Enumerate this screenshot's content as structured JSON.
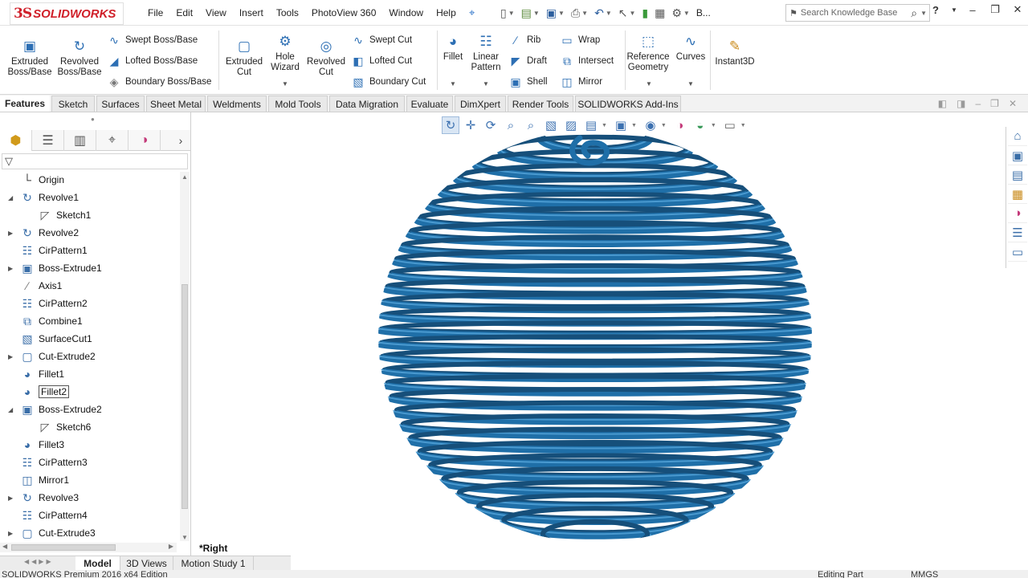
{
  "app": {
    "logo_ds": "3S",
    "logo_name": "SOLIDWORKS"
  },
  "menu": [
    "File",
    "Edit",
    "View",
    "Insert",
    "Tools",
    "PhotoView 360",
    "Window",
    "Help"
  ],
  "quick_access": {
    "extra_label": "B...",
    "search_placeholder": "Search Knowledge Base",
    "help": "?"
  },
  "ribbon": {
    "extruded_boss": [
      "Extruded",
      "Boss/Base"
    ],
    "revolved_boss": [
      "Revolved",
      "Boss/Base"
    ],
    "swept_boss": "Swept Boss/Base",
    "lofted_boss": "Lofted Boss/Base",
    "boundary_boss": "Boundary Boss/Base",
    "extruded_cut": [
      "Extruded",
      "Cut"
    ],
    "hole_wizard": [
      "Hole",
      "Wizard"
    ],
    "revolved_cut": [
      "Revolved",
      "Cut"
    ],
    "swept_cut": "Swept Cut",
    "lofted_cut": "Lofted Cut",
    "boundary_cut": "Boundary Cut",
    "fillet": "Fillet",
    "linear_pattern": [
      "Linear",
      "Pattern"
    ],
    "rib": "Rib",
    "draft": "Draft",
    "shell": "Shell",
    "wrap": "Wrap",
    "intersect": "Intersect",
    "mirror": "Mirror",
    "reference_geometry": [
      "Reference",
      "Geometry"
    ],
    "curves": "Curves",
    "instant3d": "Instant3D"
  },
  "cm_tabs": [
    "Features",
    "Sketch",
    "Surfaces",
    "Sheet Metal",
    "Weldments",
    "Mold Tools",
    "Data Migration",
    "Evaluate",
    "DimXpert",
    "Render Tools",
    "SOLIDWORKS Add-Ins"
  ],
  "tree": [
    {
      "label": "Origin"
    },
    {
      "label": "Revolve1"
    },
    {
      "label": "Sketch1"
    },
    {
      "label": "Revolve2"
    },
    {
      "label": "CirPattern1"
    },
    {
      "label": "Boss-Extrude1"
    },
    {
      "label": "Axis1"
    },
    {
      "label": "CirPattern2"
    },
    {
      "label": "Combine1"
    },
    {
      "label": "SurfaceCut1"
    },
    {
      "label": "Cut-Extrude2"
    },
    {
      "label": "Fillet1"
    },
    {
      "label": "Fillet2"
    },
    {
      "label": "Boss-Extrude2"
    },
    {
      "label": "Sketch6"
    },
    {
      "label": "Fillet3"
    },
    {
      "label": "CirPattern3"
    },
    {
      "label": "Mirror1"
    },
    {
      "label": "Revolve3"
    },
    {
      "label": "CirPattern4"
    },
    {
      "label": "Cut-Extrude3"
    }
  ],
  "viewport": {
    "view_label": "*Right",
    "model_color": "#1f6fa8"
  },
  "bottom_tabs": [
    "Model",
    "3D Views",
    "Motion Study 1"
  ],
  "status": {
    "left": "SOLIDWORKS Premium 2016 x64 Edition",
    "mid": "Editing Part",
    "right": "MMGS"
  }
}
